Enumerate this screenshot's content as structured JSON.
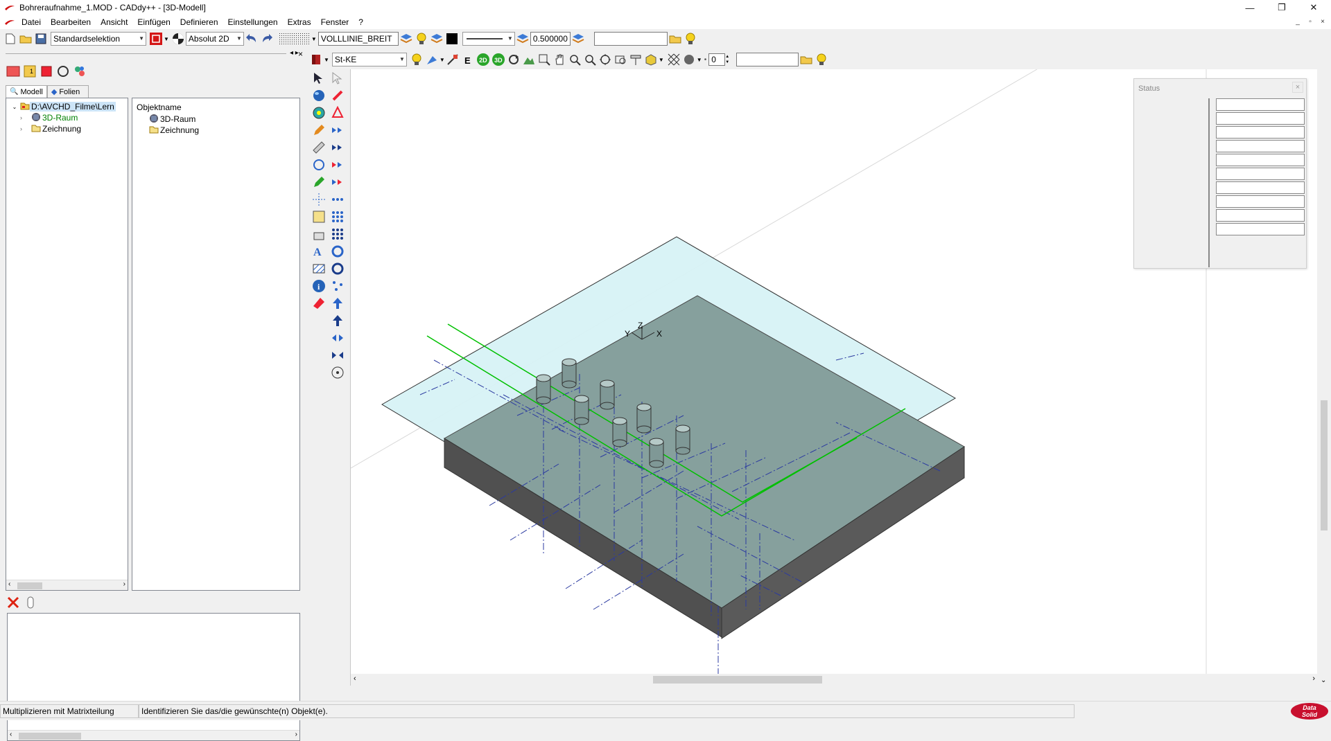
{
  "window": {
    "title": "Bohreraufnahme_1.MOD  -  CADdy++ - [3D-Modell]",
    "minimize": "—",
    "restore": "❐",
    "close": "✕"
  },
  "menu": [
    "Datei",
    "Bearbeiten",
    "Ansicht",
    "Einfügen",
    "Definieren",
    "Einstellungen",
    "Extras",
    "Fenster",
    "?"
  ],
  "toolbar1": {
    "selection_mode": "Standardselektion",
    "coord_mode": "Absolut 2D",
    "linetype": "VOLLLINIE_BREIT",
    "line_width": "0.500000",
    "text_input": ""
  },
  "toolbar2": {
    "layer": "St-KE",
    "spin_value": "0",
    "text_input": "",
    "btn_2d": "2D",
    "btn_3d": "3D"
  },
  "leftpanel": {
    "tabs": [
      "Modell",
      "Folien"
    ],
    "tree": {
      "root": "D:\\AVCHD_Filme\\Lern",
      "children": [
        "3D-Raum",
        "Zeichnung"
      ]
    },
    "list_header": "Objektname",
    "list_items": [
      "3D-Raum",
      "Zeichnung"
    ]
  },
  "status_panel": {
    "title": "Status",
    "close": "×",
    "rows": 10
  },
  "statusbar": {
    "left": "Multiplizieren mit Matrixteilung",
    "message": "Identifizieren Sie das/die gewünschte(n) Objekt(e).",
    "brand_line1": "Data",
    "brand_line2": "Solid"
  },
  "axes": {
    "x": "X",
    "y": "Y",
    "z": "Z"
  },
  "colors": {
    "accent_green": "#00c000",
    "tree_highlight": "#008000",
    "plane": "#d8f3f6",
    "plate_top": "#86a09d",
    "plate_side": "#505050",
    "brand_red": "#c8102e"
  }
}
